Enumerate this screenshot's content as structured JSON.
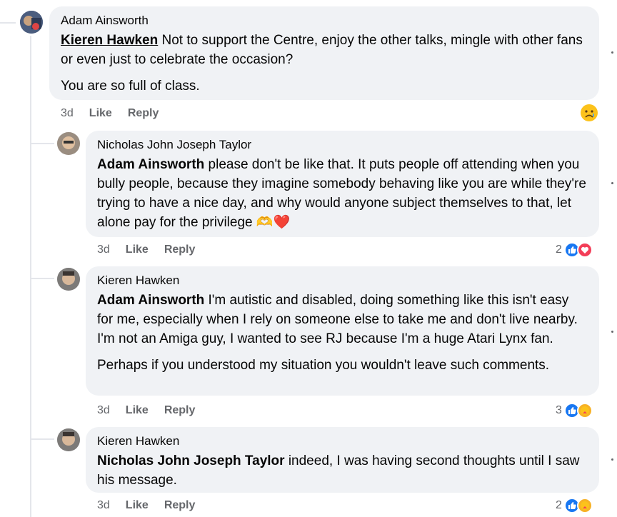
{
  "comments": [
    {
      "author": "Adam Ainsworth",
      "mention": "Kieren Hawken",
      "paragraphs": [
        " Not to support the Centre, enjoy the other talks, mingle with other fans or even just to celebrate the occasion?",
        "You are so full of class."
      ],
      "time": "3d",
      "like_label": "Like",
      "reply_label": "Reply",
      "reaction": "sad"
    },
    {
      "author": "Nicholas John Joseph Taylor",
      "mention": "Adam Ainsworth",
      "paragraphs": [
        " please don't be like that. It puts people off attending when you bully people, because they imagine somebody behaving like you are while they're trying to have a nice day, and why would anyone subject themselves to that, let alone pay for the privilege 🫶❤️"
      ],
      "time": "3d",
      "like_label": "Like",
      "reply_label": "Reply",
      "reaction_count": "2",
      "reactions": [
        "like",
        "love"
      ]
    },
    {
      "author": "Kieren Hawken",
      "mention": "Adam Ainsworth",
      "paragraphs": [
        " I'm autistic and disabled, doing something like this isn't easy for me, especially when I rely on someone else to take me and don't live nearby. I'm not an Amiga guy, I wanted to see RJ because I'm a huge Atari Lynx fan.",
        "Perhaps if you understood my situation you wouldn't leave such comments."
      ],
      "time": "3d",
      "like_label": "Like",
      "reply_label": "Reply",
      "reaction_count": "3",
      "reactions": [
        "like",
        "care"
      ]
    },
    {
      "author": "Kieren Hawken",
      "mention": "Nicholas John Joseph Taylor",
      "paragraphs": [
        " indeed, I was having second thoughts until I saw his message."
      ],
      "time": "3d",
      "like_label": "Like",
      "reply_label": "Reply",
      "reaction_count": "2",
      "reactions": [
        "like",
        "care"
      ]
    }
  ]
}
